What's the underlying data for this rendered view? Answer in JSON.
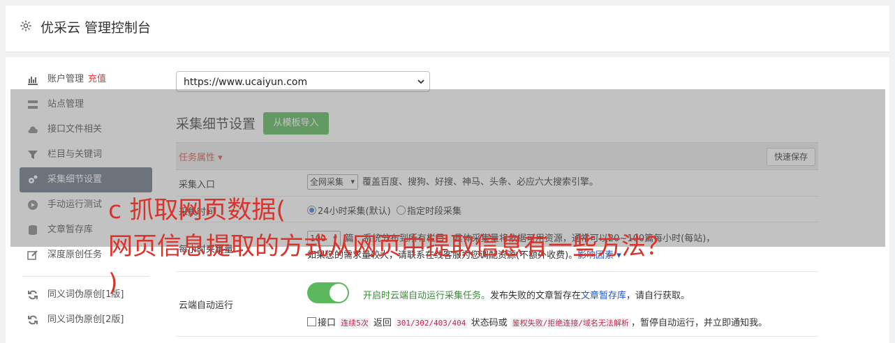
{
  "header": {
    "title": "优采云 管理控制台",
    "icon": "gear-icon"
  },
  "sidebar": {
    "items": [
      {
        "label": "账户管理",
        "badge": "充值",
        "icon": "bar-chart-icon"
      },
      {
        "label": "站点管理",
        "icon": "server-icon"
      },
      {
        "label": "接口文件相关",
        "icon": "cloud-upload-icon"
      },
      {
        "label": "栏目与关键词",
        "icon": "filter-icon"
      },
      {
        "label": "采集细节设置",
        "icon": "cogs-icon",
        "active": true
      },
      {
        "label": "手动运行测试",
        "icon": "play-circle-icon"
      },
      {
        "label": "文章暂存库",
        "icon": "database-icon"
      },
      {
        "label": "深度原创任务",
        "icon": "edit-icon"
      }
    ],
    "extra_items": [
      {
        "label": "同义词伪原创[1版]",
        "icon": "refresh-icon"
      },
      {
        "label": "同义词伪原创[2版]",
        "icon": "refresh-icon"
      }
    ]
  },
  "site_select": {
    "value": "https://www.ucaiyun.com"
  },
  "section": {
    "title": "采集细节设置",
    "import_button": "从模板导入"
  },
  "task_props": {
    "label": "任务属性 ▾",
    "quick_save": "快速保存"
  },
  "rows": {
    "entry": {
      "key": "采集入口",
      "select": "全网采集",
      "desc": "覆盖百度、搜狗、好搜、神马、头条、必应六大搜索引擎。"
    },
    "time": {
      "key": "采集时间",
      "opt1": "24小时采集(默认)",
      "opt2": "指定时段采集"
    },
    "volume": {
      "key": "每小时采集量",
      "select": "100",
      "line1": "篇，系统分布到所有栏目，具体采集量将依据可用资源，通常可以20~100篇每小时(每站)，",
      "line2": "如果您的需求量较大，请联系在线客服为您调配资源(不额外收费)。",
      "link": "影响因素 ▾"
    },
    "cloud": {
      "key": "云端自动运行",
      "green_text": "开启时云端自动运行采集任务。",
      "text_a": "发布失败的文章暂存在",
      "link": "文章暂存库",
      "text_b": "，请自行获取。",
      "api_label": "接口",
      "code1": "连续5次",
      "text_c": "返回",
      "code2": "301/302/403/404",
      "text_d": "状态码或",
      "code3": "鉴权失败/拒绝连接/域名无法解析",
      "text_e": "，暂停自动运行，并立即通知我。"
    }
  },
  "overlay_headline": {
    "line1": "c 抓取网页数据(",
    "line2": "网页信息提取的方式从网页中提取信息有一些方法？",
    "line3": ")"
  },
  "colors": {
    "accent_green": "#5cb85c",
    "active_sidebar": "#6b7785",
    "headline_red": "#d9342b"
  }
}
